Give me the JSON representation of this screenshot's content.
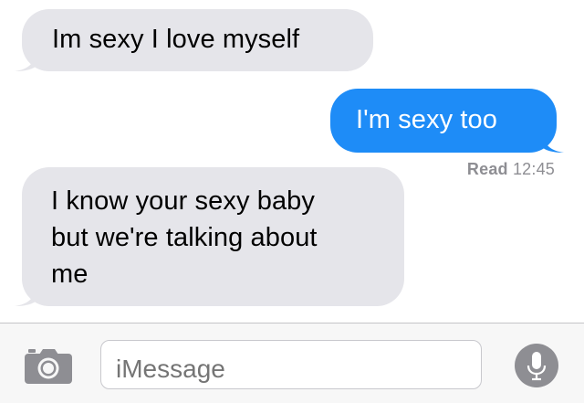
{
  "messages": [
    {
      "direction": "incoming",
      "text": "Im sexy I love myself"
    },
    {
      "direction": "outgoing",
      "text": "I'm sexy too"
    },
    {
      "direction": "incoming",
      "lines": [
        "I know your sexy baby",
        "but we're talking about",
        "me"
      ]
    }
  ],
  "read_receipt": {
    "label": "Read",
    "time": "12:45"
  },
  "composer": {
    "placeholder": "iMessage",
    "camera_icon": "camera-icon",
    "mic_icon": "microphone-icon"
  },
  "colors": {
    "incoming_bubble": "#e5e5ea",
    "outgoing_bubble": "#1e8cf7",
    "receipt_text": "#8e8e93"
  }
}
